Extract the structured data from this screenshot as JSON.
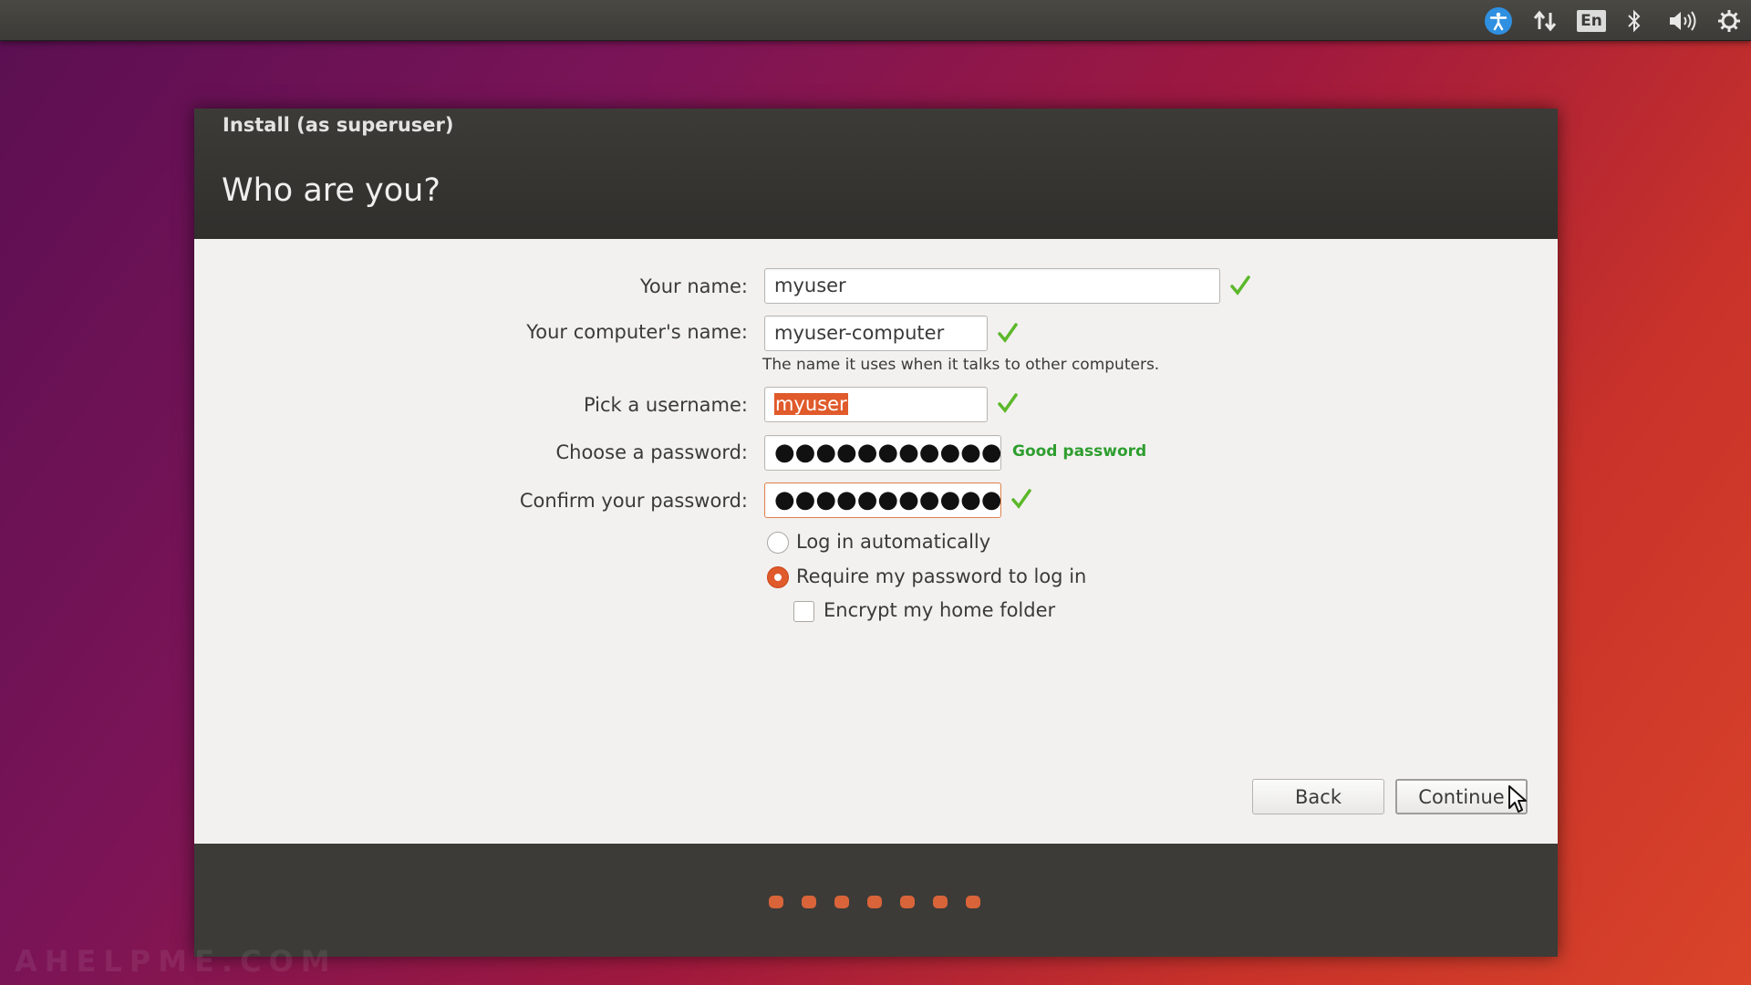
{
  "panel": {
    "language": "En",
    "icons": [
      "accessibility-icon",
      "network-icon",
      "keyboard-language-icon",
      "bluetooth-icon",
      "volume-icon",
      "settings-gear-icon"
    ]
  },
  "window": {
    "title": "Install (as superuser)",
    "page_title": "Who are you?"
  },
  "form": {
    "name_label": "Your name:",
    "name_value": "myuser",
    "computer_label": "Your computer's name:",
    "computer_value": "myuser-computer",
    "computer_hint": "The name it uses when it talks to other computers.",
    "username_label": "Pick a username:",
    "username_value": "myuser",
    "password_label": "Choose a password:",
    "password_value": "●●●●●●●●●●●●",
    "password_strength": "Good password",
    "confirm_label": "Confirm your password:",
    "confirm_value": "●●●●●●●●●●●●"
  },
  "login": {
    "auto_label": "Log in automatically",
    "auto_checked": false,
    "require_label": "Require my password to log in",
    "require_checked": true,
    "encrypt_label": "Encrypt my home folder",
    "encrypt_checked": false
  },
  "buttons": {
    "back": "Back",
    "continue": "Continue"
  },
  "progress": {
    "total_steps": 7
  },
  "watermark": "AHELPME.COM",
  "colors": {
    "accent": "#e05a2b",
    "check": "#5cb82a",
    "good_password": "#2e9e2e",
    "header": "#3c3b37"
  }
}
